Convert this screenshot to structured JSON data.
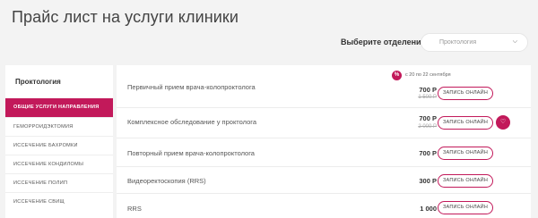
{
  "page": {
    "title": "Прайс лист на услуги клиники"
  },
  "department": {
    "label": "Выберите отделение",
    "selected": "Проктология"
  },
  "sidebar": {
    "title": "Проктология",
    "items": [
      {
        "label": "ОБЩИЕ УСЛУГИ НАПРАВЛЕНИЯ",
        "active": true
      },
      {
        "label": "ГЕМОРРОИДЭКТОМИЯ"
      },
      {
        "label": "ИССЕЧЕНИЕ БАХРОМКИ"
      },
      {
        "label": "ИССЕЧЕНИЕ КОНДИЛОМЫ"
      },
      {
        "label": "ИССЕЧЕНИЕ ПОЛИП"
      },
      {
        "label": "ИССЕЧЕНИЕ СВИЩ"
      }
    ]
  },
  "services": [
    {
      "name": "Первичный прием врача-колопроктолога",
      "price": "700 Р",
      "old_price": "1 500 Р",
      "button": "ЗАПИСЬ ОНЛАЙН",
      "promo": {
        "badge": "%",
        "text": "с 20 по 22 сентября"
      }
    },
    {
      "name": "Комплексное обследование у проктолога",
      "price": "700 Р",
      "old_price": "2 000 Р",
      "button": "ЗАПИСЬ ОНЛАЙН",
      "icon": "heart-icon"
    },
    {
      "name": "Повторный прием врача-колопроктолога",
      "price": "700 Р",
      "button": "ЗАПИСЬ ОНЛАЙН"
    },
    {
      "name": "Видеоректоскопия (RRS)",
      "price": "300 Р",
      "button": "ЗАПИСЬ ОНЛАЙН"
    },
    {
      "name": "RRS",
      "price": "1 000",
      "button": "ЗАПИСЬ ОНЛАЙН"
    }
  ],
  "colors": {
    "accent": "#c2195a",
    "background": "#f3f3f3"
  }
}
